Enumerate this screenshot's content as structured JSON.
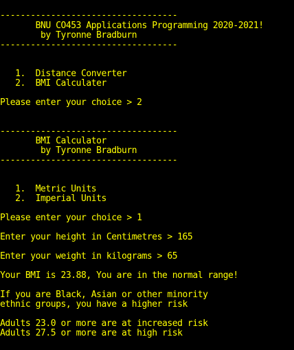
{
  "console": {
    "text_color": "#ffff00",
    "background_color": "#000000",
    "lines": [
      "-----------------------------------",
      "       BNU CO453 Applications Programming 2020-2021!",
      "        by Tyronne Bradburn",
      "-----------------------------------",
      "",
      "",
      "   1.  Distance Converter",
      "   2.  BMI Calculater",
      "",
      "Please enter your choice > 2",
      "",
      "",
      "-----------------------------------",
      "       BMI Calculator",
      "        by Tyronne Bradburn",
      "-----------------------------------",
      "",
      "",
      "   1.  Metric Units",
      "   2.  Imperial Units",
      "",
      "Please enter your choice > 1",
      "",
      "Enter your height in Centimetres > 165",
      "",
      "Enter your weight in kilograms > 65",
      "",
      "Your BMI is 23.88, You are in the normal range!",
      "",
      "If you are Black, Asian or other minority",
      "ethnic groups, you have a higher risk",
      "",
      "Adults 23.0 or more are at increased risk",
      "Adults 27.5 or more are at high risk"
    ]
  }
}
